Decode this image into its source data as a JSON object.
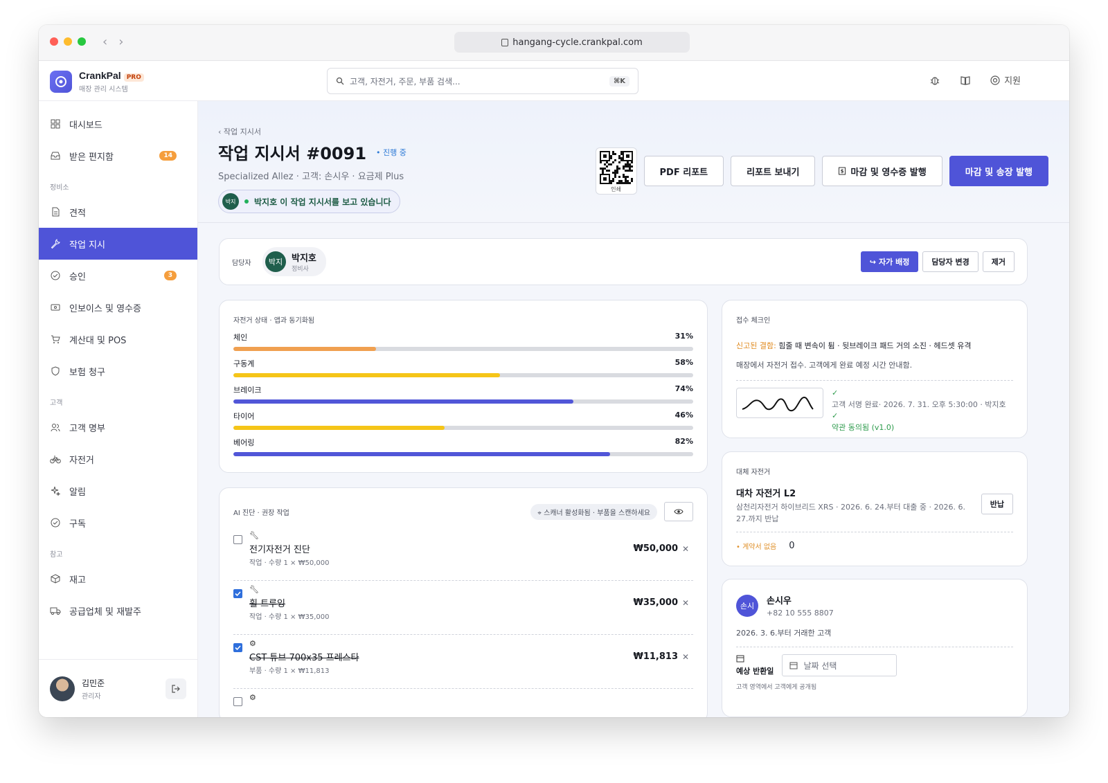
{
  "browser": {
    "url": "hangang-cycle.crankpal.com"
  },
  "brand": {
    "name": "CrankPal",
    "tier": "PRO",
    "subtitle": "매장 관리 시스템"
  },
  "search": {
    "placeholder": "고객, 자전거, 주문, 부품 검색...",
    "shortcut": "⌘K"
  },
  "header": {
    "support_label": "지원"
  },
  "sidebar": {
    "items_top": [
      {
        "label": "대시보드",
        "icon": "dashboard-icon"
      },
      {
        "label": "받은 편지함",
        "icon": "inbox-icon",
        "badge": "14"
      }
    ],
    "section_shop": "정비소",
    "items_shop": [
      {
        "label": "견적",
        "icon": "document-icon"
      },
      {
        "label": "작업 지시",
        "icon": "wrench-icon",
        "active": true
      },
      {
        "label": "승인",
        "icon": "check-circle-icon",
        "badge": "3"
      },
      {
        "label": "인보이스 및 영수증",
        "icon": "receipt-icon"
      },
      {
        "label": "계산대 및 POS",
        "icon": "cart-icon"
      },
      {
        "label": "보험 청구",
        "icon": "shield-icon"
      }
    ],
    "section_customers": "고객",
    "items_customers": [
      {
        "label": "고객 명부",
        "icon": "users-icon"
      },
      {
        "label": "자전거",
        "icon": "bike-icon"
      },
      {
        "label": "알림",
        "icon": "sparkle-icon"
      },
      {
        "label": "구독",
        "icon": "check-circle-icon"
      }
    ],
    "section_reference": "참고",
    "items_reference": [
      {
        "label": "재고",
        "icon": "box-icon"
      },
      {
        "label": "공급업체 및 재발주",
        "icon": "truck-icon"
      }
    ],
    "user": {
      "name": "김민준",
      "role": "관리자"
    }
  },
  "workorder": {
    "breadcrumb": "‹ 작업 지시서",
    "title": "작업 지시서 #0091",
    "status": "• 진행 중",
    "subtitle": "Specialized Allez · 고객: 손시우 · 요금제 Plus",
    "viewer_initials": "박지",
    "viewer_text": "박지호 이 작업 지시서를 보고 있습니다",
    "qr_label": "인쇄",
    "btn_pdf": "PDF 리포트",
    "btn_send": "리포트 보내기",
    "btn_close_receipt": "마감 및 영수증 발행",
    "btn_close_invoice": "마감 및 송장 발행"
  },
  "assignee": {
    "label": "담당자",
    "initials": "박지",
    "name": "박지호",
    "role": "정비사",
    "btn_self": "자가 배정",
    "btn_change": "담당자 변경",
    "btn_remove": "제거"
  },
  "condition": {
    "title": "자전거 상태 · 앱과 동기화됨",
    "items": [
      {
        "label": "체인",
        "pct_text": "31%",
        "value": 31,
        "color": "#f0a050"
      },
      {
        "label": "구동계",
        "pct_text": "58%",
        "value": 58,
        "color": "#f5c518"
      },
      {
        "label": "브레이크",
        "pct_text": "74%",
        "value": 74,
        "color": "#5156d8"
      },
      {
        "label": "타이어",
        "pct_text": "46%",
        "value": 46,
        "color": "#f5c518"
      },
      {
        "label": "베어링",
        "pct_text": "82%",
        "value": 82,
        "color": "#5156d8"
      }
    ]
  },
  "ai": {
    "title": "AI 진단 · 권장 작업",
    "scanner": "⌖ 스캐너 활성화됨 · 부품을 스캔하세요",
    "tasks": [
      {
        "icon": "wrench-icon",
        "name": "전기자전거 진단",
        "sub": "작업 · 수량 1 × ₩50,000",
        "price": "₩50,000",
        "checked": false
      },
      {
        "icon": "wrench-icon",
        "name": "휠 트루잉",
        "sub": "작업 · 수량 1 × ₩35,000",
        "price": "₩35,000",
        "checked": true
      },
      {
        "icon": "gear-icon",
        "name": "CST 튜브 700x35 프레스타",
        "sub": "부품 · 수량 1 × ₩11,813",
        "price": "₩11,813",
        "checked": true
      }
    ]
  },
  "checkin": {
    "title": "접수 체크인",
    "reported_label": "신고된 결함:",
    "reported_text": " 힘줄 때 변속이 튐 · 뒷브레이크 패드 거의 소진 · 헤드셋 유격",
    "note": "매장에서 자전거 접수. 고객에게 완료 예정 시간 안내함.",
    "signed": "고객 서명 완료· 2026. 7. 31. 오후 5:30:00 · 박지호",
    "terms": "약관 동의됨 (v1.0)"
  },
  "loaner": {
    "title": "대체 자전거",
    "name": "대차 자전거 L2",
    "desc": "삼천리자전거 하이브리드 XRS · 2026. 6. 24.부터 대출 중 · 2026. 6. 27.까지 반납",
    "btn_return": "반납",
    "no_contract": "• 계약서 없음",
    "count": "0"
  },
  "customer": {
    "initials": "손시",
    "name": "손시우",
    "phone": "+82 10 555 8807",
    "since": "2026. 3. 6.부터 거래한 고객",
    "return_label": "예상 반환일",
    "date_placeholder": "날짜 선택",
    "note": "고객 영역에서 고객에게 공개됨"
  }
}
